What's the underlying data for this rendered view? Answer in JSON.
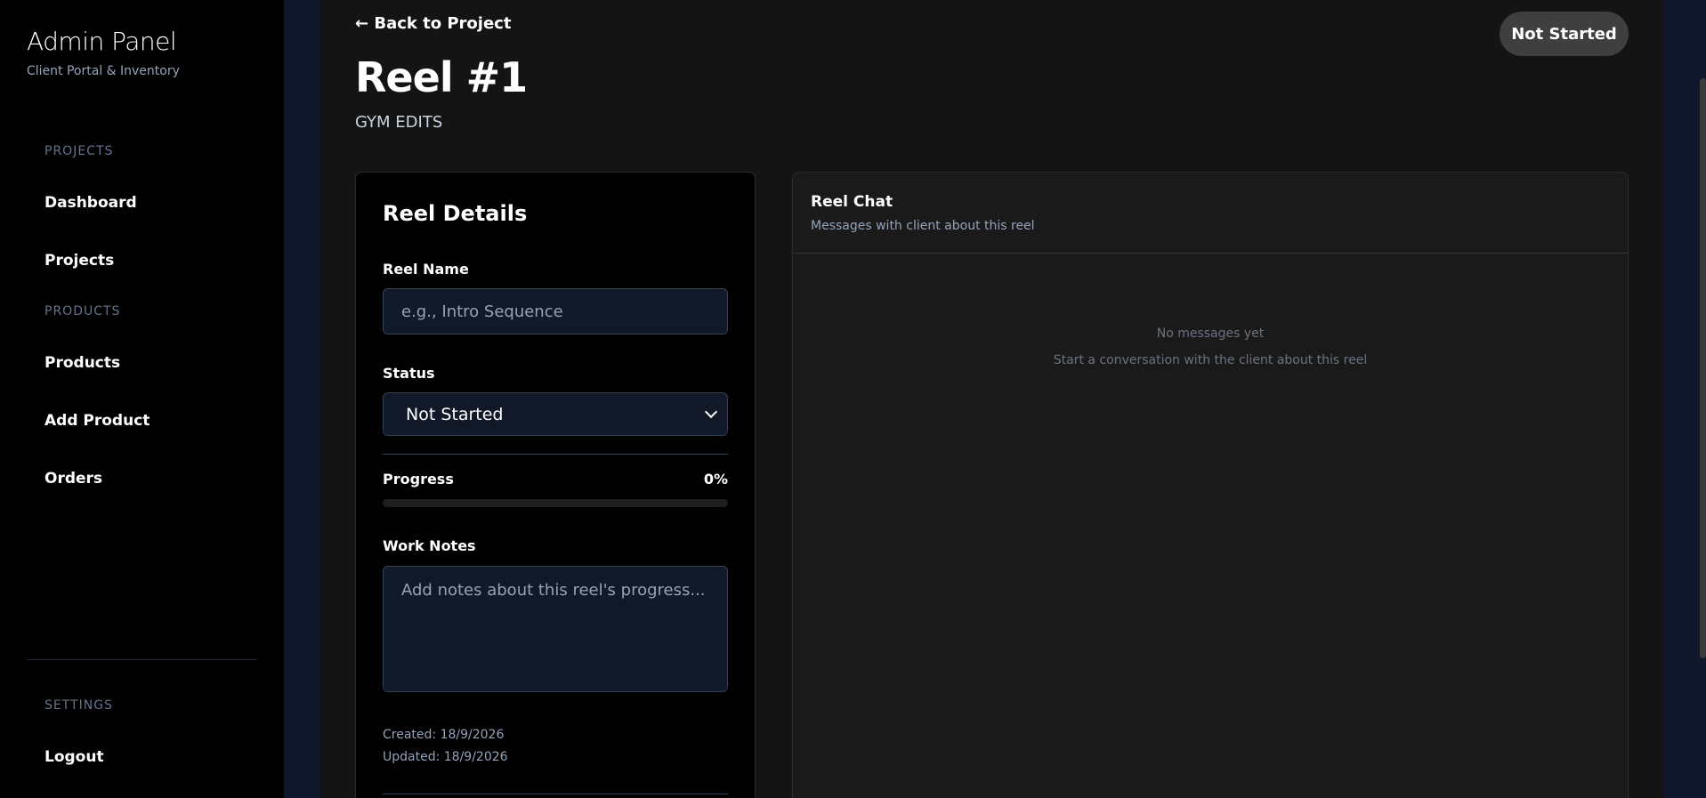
{
  "sidebar": {
    "title": "Admin Panel",
    "subtitle": "Client Portal & Inventory",
    "sections": {
      "projects": "PROJECTS",
      "products": "PRODUCTS",
      "settings": "SETTINGS"
    },
    "items": {
      "dashboard": "Dashboard",
      "projects": "Projects",
      "products": "Products",
      "add_product": "Add Product",
      "orders": "Orders",
      "logout": "Logout"
    }
  },
  "header": {
    "back_label": "← Back to Project",
    "title": "Reel #1",
    "subtitle": "GYM EDITS",
    "status_badge": "Not Started"
  },
  "details": {
    "title": "Reel Details",
    "reel_name_label": "Reel Name",
    "reel_name_value": "",
    "reel_name_placeholder": "e.g., Intro Sequence",
    "status_label": "Status",
    "status_value": "Not Started",
    "progress_label": "Progress",
    "progress_text": "0%",
    "progress_percent": 0,
    "notes_label": "Work Notes",
    "notes_value": "",
    "notes_placeholder": "Add notes about this reel's progress...",
    "created": "Created: 18/9/2026",
    "updated": "Updated: 18/9/2026"
  },
  "chat": {
    "title": "Reel Chat",
    "subtitle": "Messages with client about this reel",
    "empty_title": "No messages yet",
    "empty_subtitle": "Start a conversation with the client about this reel"
  },
  "colors": {
    "sidebar_bg": "#000000",
    "main_bg": "#141414",
    "page_bg": "#0f172a",
    "input_bg": "#111827",
    "badge_bg": "#3f3f3f"
  },
  "icons": {
    "select_chevron": "chevron-down-icon"
  }
}
